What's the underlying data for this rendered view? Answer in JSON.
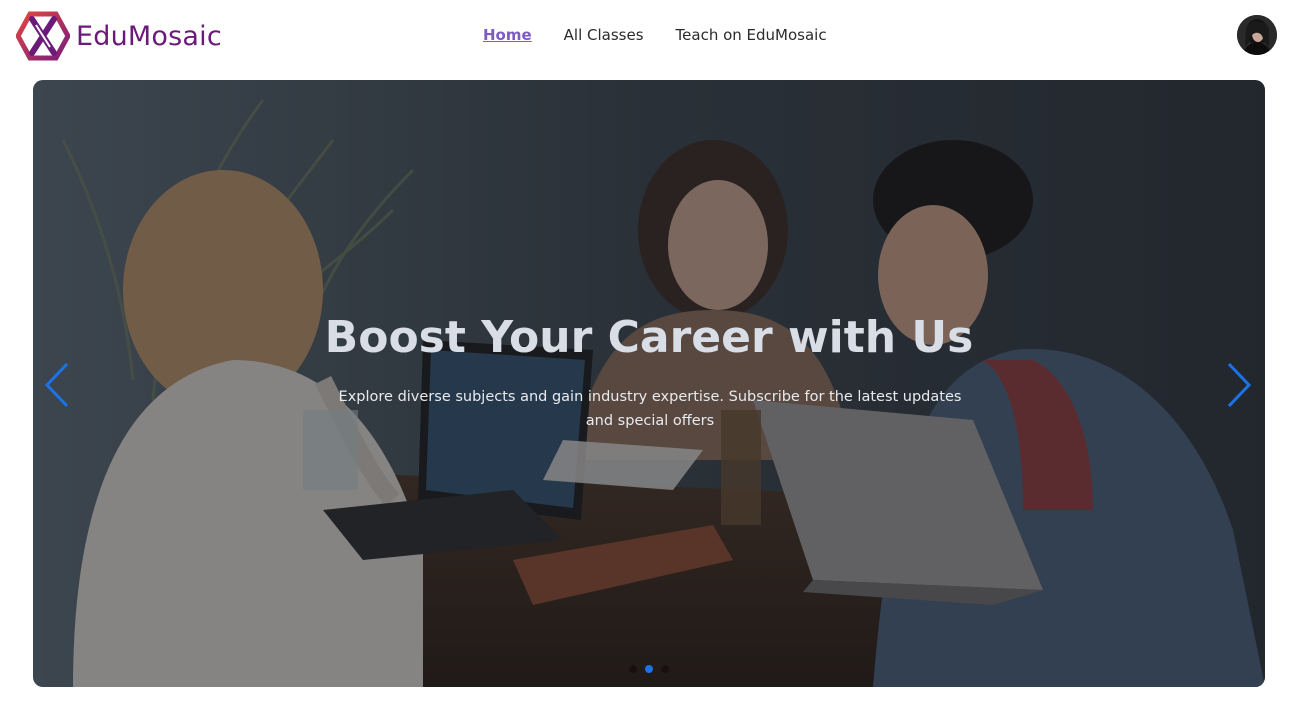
{
  "brand": {
    "name": "EduMosaic",
    "logo_icon": "edumosaic-logo-icon"
  },
  "nav": {
    "links": [
      {
        "label": "Home",
        "active": true
      },
      {
        "label": "All Classes",
        "active": false
      },
      {
        "label": "Teach on EduMosaic",
        "active": false
      }
    ]
  },
  "user": {
    "avatar_icon": "user-avatar"
  },
  "hero": {
    "title": "Boost Your Career with Us",
    "subtitle": "Explore diverse subjects and gain industry expertise. Subscribe for the latest updates and special offers",
    "prev_icon": "chevron-left-icon",
    "next_icon": "chevron-right-icon",
    "slides_count": 3,
    "active_slide": 2
  },
  "colors": {
    "brand_purple": "#6b1a7a",
    "nav_active": "#7c5bc4",
    "carousel_accent": "#1a73e8"
  }
}
